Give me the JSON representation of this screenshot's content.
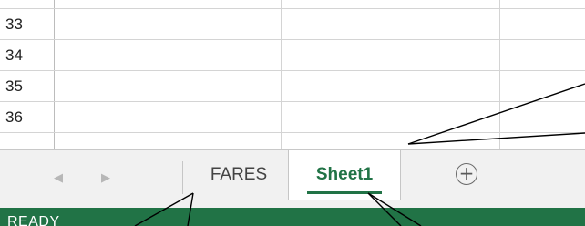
{
  "rows": [
    {
      "number": "33"
    },
    {
      "number": "34"
    },
    {
      "number": "35"
    },
    {
      "number": "36"
    }
  ],
  "tabs": {
    "sheets": [
      {
        "label": "FARES",
        "active": false
      },
      {
        "label": "Sheet1",
        "active": true
      }
    ],
    "prev_icon": "chevron-left-icon",
    "next_icon": "chevron-right-icon",
    "add_icon": "plus-circle-icon"
  },
  "status": {
    "text": "READY"
  },
  "colors": {
    "accent": "#217346",
    "tab_bar_bg": "#f1f1f1",
    "gridline": "#d4d4d4"
  }
}
